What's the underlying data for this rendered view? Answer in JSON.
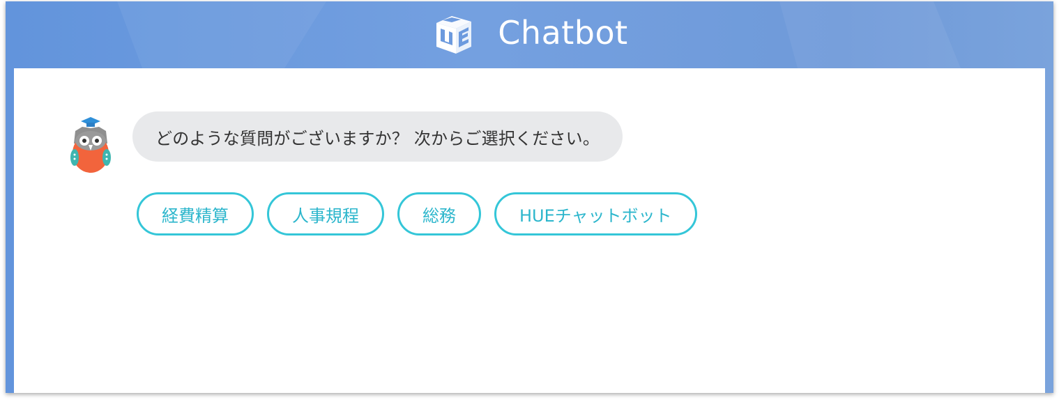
{
  "header": {
    "title": "Chatbot",
    "logo_icon": "hue-cube-logo-icon"
  },
  "chat": {
    "avatar_icon": "owl-graduate-icon",
    "message": "どのような質問がございますか？ 次からご選択ください。"
  },
  "options": [
    {
      "label": "経費精算"
    },
    {
      "label": "人事規程"
    },
    {
      "label": "総務"
    },
    {
      "label": "HUEチャットボット"
    }
  ],
  "colors": {
    "header_gradient_start": "#6294dc",
    "header_gradient_end": "#7aa3dc",
    "bubble_bg": "#e8e9eb",
    "option_border": "#34c6d8",
    "option_text": "#2cb6cc",
    "owl_body": "#f2643c",
    "owl_cap": "#2f8fd8"
  }
}
